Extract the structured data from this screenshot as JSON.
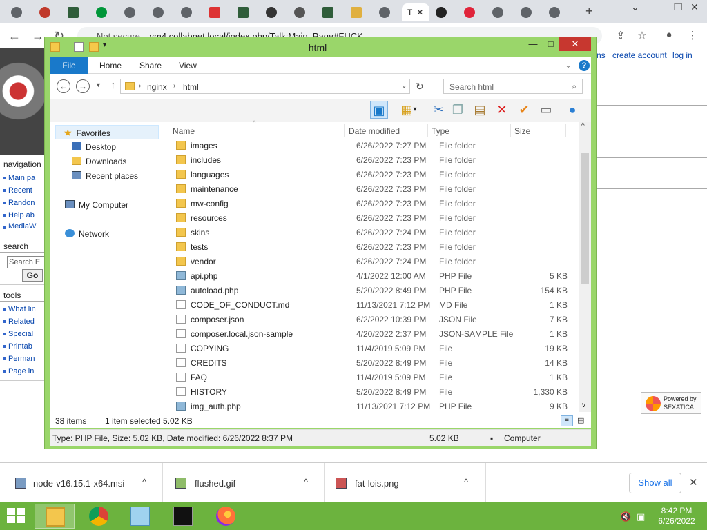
{
  "browser": {
    "tabs": [
      {
        "icon": "circle-icon"
      },
      {
        "icon": "ublock-icon"
      },
      {
        "icon": "sql-icon"
      },
      {
        "icon": "nginx-icon"
      },
      {
        "icon": "download-icon"
      },
      {
        "icon": "circle-icon"
      },
      {
        "icon": "circle-icon"
      },
      {
        "icon": "pdf-icon"
      },
      {
        "icon": "sql-icon"
      },
      {
        "icon": "github-icon"
      },
      {
        "icon": "diamond-icon"
      },
      {
        "icon": "sql-icon"
      },
      {
        "icon": "folder-icon"
      },
      {
        "icon": "gear-icon"
      },
      {
        "icon": "active-tab",
        "label": "T"
      },
      {
        "icon": "mask-icon"
      },
      {
        "icon": "opera-icon"
      },
      {
        "icon": "circle-icon"
      },
      {
        "icon": "circle-icon"
      },
      {
        "icon": "gear-icon"
      }
    ],
    "new_tab": "+",
    "url_prefix": "Not secure",
    "url": "vm4.collabnet.local/index.php/Talk:Main_Page#FUCK"
  },
  "wiki": {
    "top_links": [
      "ns",
      "create account",
      "log in"
    ],
    "sections": [
      {
        "title": "navigation",
        "links": [
          "Main pa",
          "Recent",
          "Randon",
          "Help ab",
          "MediaW"
        ]
      },
      {
        "title": "search",
        "placeholder": "Search E",
        "go": "Go"
      },
      {
        "title": "tools",
        "links": [
          "What lin",
          "Related",
          "Special",
          "Printab",
          "Perman",
          "Page in"
        ]
      }
    ],
    "powered": {
      "line1": "Powered by",
      "line2": "SEXATICA"
    }
  },
  "explorer": {
    "title": "html",
    "ribbon_tabs": [
      "File",
      "Home",
      "Share",
      "View"
    ],
    "path": [
      "nginx",
      "html"
    ],
    "search_placeholder": "Search html",
    "nav": {
      "favorites": "Favorites",
      "favorites_items": [
        "Desktop",
        "Downloads",
        "Recent places"
      ],
      "computer": "My Computer",
      "network": "Network"
    },
    "columns": [
      "Name",
      "Date modified",
      "Type",
      "Size"
    ],
    "files": [
      {
        "name": "images",
        "date": "6/26/2022 7:27 PM",
        "type": "File folder",
        "size": "",
        "kind": "folder"
      },
      {
        "name": "includes",
        "date": "6/26/2022 7:23 PM",
        "type": "File folder",
        "size": "",
        "kind": "folder"
      },
      {
        "name": "languages",
        "date": "6/26/2022 7:23 PM",
        "type": "File folder",
        "size": "",
        "kind": "folder"
      },
      {
        "name": "maintenance",
        "date": "6/26/2022 7:23 PM",
        "type": "File folder",
        "size": "",
        "kind": "folder"
      },
      {
        "name": "mw-config",
        "date": "6/26/2022 7:23 PM",
        "type": "File folder",
        "size": "",
        "kind": "folder"
      },
      {
        "name": "resources",
        "date": "6/26/2022 7:23 PM",
        "type": "File folder",
        "size": "",
        "kind": "folder"
      },
      {
        "name": "skins",
        "date": "6/26/2022 7:24 PM",
        "type": "File folder",
        "size": "",
        "kind": "folder"
      },
      {
        "name": "tests",
        "date": "6/26/2022 7:23 PM",
        "type": "File folder",
        "size": "",
        "kind": "folder"
      },
      {
        "name": "vendor",
        "date": "6/26/2022 7:24 PM",
        "type": "File folder",
        "size": "",
        "kind": "folder"
      },
      {
        "name": "api.php",
        "date": "4/1/2022 12:00 AM",
        "type": "PHP File",
        "size": "5 KB",
        "kind": "php"
      },
      {
        "name": "autoload.php",
        "date": "5/20/2022 8:49 PM",
        "type": "PHP File",
        "size": "154 KB",
        "kind": "php"
      },
      {
        "name": "CODE_OF_CONDUCT.md",
        "date": "11/13/2021 7:12 PM",
        "type": "MD File",
        "size": "1 KB",
        "kind": "doc"
      },
      {
        "name": "composer.json",
        "date": "6/2/2022 10:39 PM",
        "type": "JSON File",
        "size": "7 KB",
        "kind": "doc"
      },
      {
        "name": "composer.local.json-sample",
        "date": "4/20/2022 2:37 PM",
        "type": "JSON-SAMPLE File",
        "size": "1 KB",
        "kind": "doc"
      },
      {
        "name": "COPYING",
        "date": "11/4/2019 5:09 PM",
        "type": "File",
        "size": "19 KB",
        "kind": "doc"
      },
      {
        "name": "CREDITS",
        "date": "5/20/2022 8:49 PM",
        "type": "File",
        "size": "14 KB",
        "kind": "doc"
      },
      {
        "name": "FAQ",
        "date": "11/4/2019 5:09 PM",
        "type": "File",
        "size": "1 KB",
        "kind": "doc"
      },
      {
        "name": "HISTORY",
        "date": "5/20/2022 8:49 PM",
        "type": "File",
        "size": "1,330 KB",
        "kind": "doc"
      },
      {
        "name": "img_auth.php",
        "date": "11/13/2021 7:12 PM",
        "type": "PHP File",
        "size": "9 KB",
        "kind": "php"
      }
    ],
    "item_count": "38 items",
    "selected": "1 item selected  5.02 KB",
    "status_text": "Type: PHP File, Size: 5.02 KB, Date modified: 6/26/2022 8:37 PM",
    "status_size": "5.02 KB",
    "status_location": "Computer"
  },
  "downloads": {
    "items": [
      "node-v16.15.1-x64.msi",
      "flushed.gif",
      "fat-lois.png"
    ],
    "show_all": "Show all"
  },
  "taskbar": {
    "time": "8:42 PM",
    "date": "6/26/2022"
  }
}
